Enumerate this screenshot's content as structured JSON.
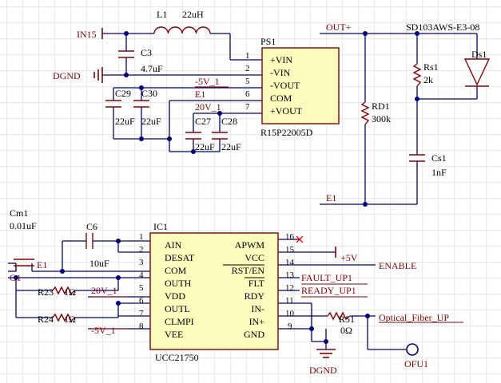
{
  "colors": {
    "grid": "#d4d4d4",
    "wire": "#000080",
    "comp": "#8b0000",
    "chip_fill": "#fcfcbc",
    "label": "#000080",
    "pin_name": "#000000",
    "junction": "#000080",
    "noconnect": "#ff0000"
  },
  "ps1": {
    "designator": "PS1",
    "part": "R15P22005D",
    "pins": [
      {
        "num": "1",
        "name": "+VIN"
      },
      {
        "num": "2",
        "name": "-VIN"
      },
      {
        "num": "5",
        "name": "-VOUT"
      },
      {
        "num": "6",
        "name": "COM"
      },
      {
        "num": "7",
        "name": "+VOUT"
      }
    ]
  },
  "ic1": {
    "designator": "IC1",
    "part": "UCC21750",
    "left_pins": [
      {
        "num": "1",
        "name": "AIN"
      },
      {
        "num": "2",
        "name": "DESAT"
      },
      {
        "num": "3",
        "name": "COM"
      },
      {
        "num": "4",
        "name": "OUTH"
      },
      {
        "num": "5",
        "name": "VDD"
      },
      {
        "num": "6",
        "name": "OUTL"
      },
      {
        "num": "7",
        "name": "CLMPI"
      },
      {
        "num": "8",
        "name": "VEE"
      }
    ],
    "right_pins": [
      {
        "num": "16",
        "name": "APWM"
      },
      {
        "num": "15",
        "name": "VCC"
      },
      {
        "num": "14",
        "name": "RST/EN"
      },
      {
        "num": "13",
        "name": "FLT"
      },
      {
        "num": "12",
        "name": "RDY"
      },
      {
        "num": "11",
        "name": "IN-"
      },
      {
        "num": "10",
        "name": "IN+"
      },
      {
        "num": "9",
        "name": "GND"
      }
    ]
  },
  "components": {
    "l1": {
      "ref": "L1",
      "value": "22uH"
    },
    "c3": {
      "ref": "C3",
      "value": "4.7uF"
    },
    "c29": {
      "ref": "C29",
      "value": "22uF"
    },
    "c30": {
      "ref": "C30",
      "value": "22uF"
    },
    "c27": {
      "ref": "C27",
      "value": "22uF"
    },
    "c28": {
      "ref": "C28",
      "value": "22uF"
    },
    "rd1": {
      "ref": "RD1",
      "value": "300k"
    },
    "rs1": {
      "ref": "Rs1",
      "value": "2k"
    },
    "cs1": {
      "ref": "Cs1",
      "value": "1nF"
    },
    "ds1": {
      "ref": "Ds1",
      "part": "SD103AWS-E3-08"
    },
    "cm1": {
      "ref": "Cm1",
      "value": "0.01uF"
    },
    "c6": {
      "ref": "C6",
      "value": "10uF"
    },
    "r23": {
      "ref": "R23",
      "value": "1Ω"
    },
    "r24": {
      "ref": "R24",
      "value": "1Ω"
    },
    "r51": {
      "ref": "R51",
      "value": "0Ω"
    }
  },
  "nets": {
    "in15": "IN15",
    "dgnd_top": "DGND",
    "neg5v_top": "-5V_1",
    "e1_top": "E1",
    "v20_top": "20V_1",
    "out_plus": "OUT+",
    "e1_right": "E1",
    "e1_left": "E1",
    "g1": "G1",
    "v20_ic": "20V_1",
    "neg5v_ic": "-5V_1",
    "plus5v": "+5V",
    "enable": "ENABLE",
    "fault": "FAULT_UP1",
    "ready": "READY_UP1",
    "fiber": "Optical_Fiber_UP",
    "dgnd_bottom": "DGND",
    "ofu1": "OFU1"
  }
}
